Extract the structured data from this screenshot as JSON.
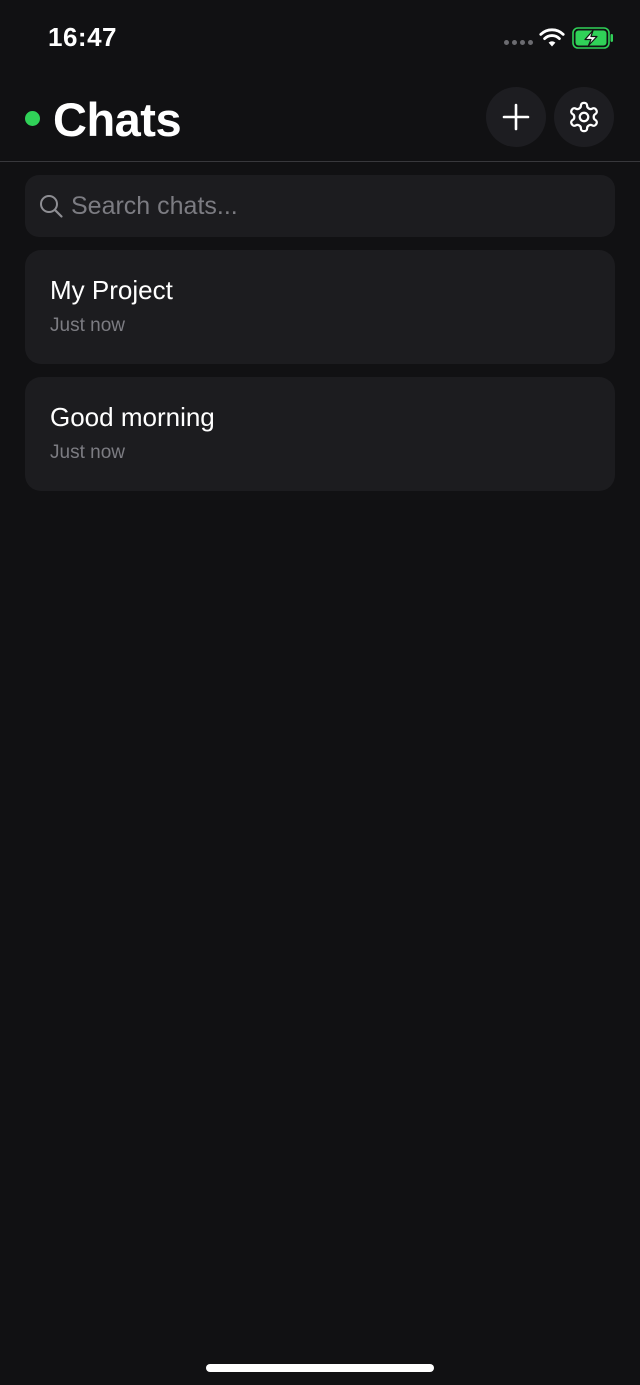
{
  "status_bar": {
    "time": "16:47"
  },
  "header": {
    "title": "Chats",
    "online_color": "#30d158"
  },
  "search": {
    "placeholder": "Search chats...",
    "value": ""
  },
  "chats": [
    {
      "title": "My Project",
      "time": "Just now"
    },
    {
      "title": "Good morning",
      "time": "Just now"
    }
  ],
  "icons": {
    "new_chat": "plus-icon",
    "settings": "gear-icon",
    "search": "search-icon",
    "wifi": "wifi-icon",
    "battery": "battery-charging-icon"
  },
  "colors": {
    "background": "#111113",
    "card": "#1c1c1f",
    "battery": "#30d158"
  }
}
